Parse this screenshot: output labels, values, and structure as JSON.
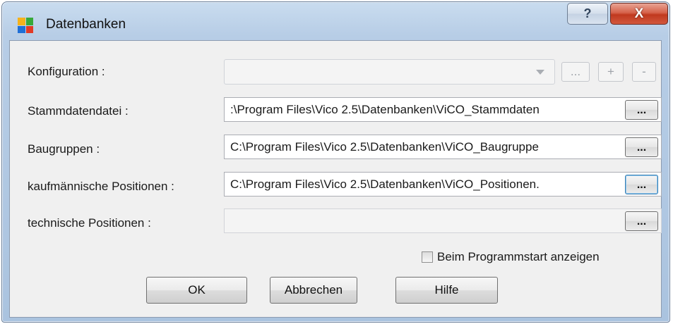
{
  "window": {
    "title": "Datenbanken",
    "help_label": "?",
    "close_label": "X"
  },
  "form": {
    "konfiguration": {
      "label": "Konfiguration :",
      "value": "",
      "browse_label": "...",
      "add_label": "+",
      "remove_label": "-"
    },
    "rows": [
      {
        "label": "Stammdatendatei :",
        "value": ":\\Program Files\\Vico 2.5\\Datenbanken\\ViCO_Stammdaten",
        "button": "..."
      },
      {
        "label": "Baugruppen :",
        "value": "C:\\Program Files\\Vico 2.5\\Datenbanken\\ViCO_Baugruppe",
        "button": "..."
      },
      {
        "label": "kaufmännische Positionen :",
        "value": "C:\\Program Files\\Vico 2.5\\Datenbanken\\ViCO_Positionen.",
        "button": "..."
      },
      {
        "label": "technische Positionen :",
        "value": "",
        "button": "..."
      }
    ],
    "show_on_start": {
      "label": "Beim Programmstart anzeigen",
      "checked": false
    }
  },
  "buttons": {
    "ok": "OK",
    "cancel": "Abbrechen",
    "help": "Hilfe"
  }
}
